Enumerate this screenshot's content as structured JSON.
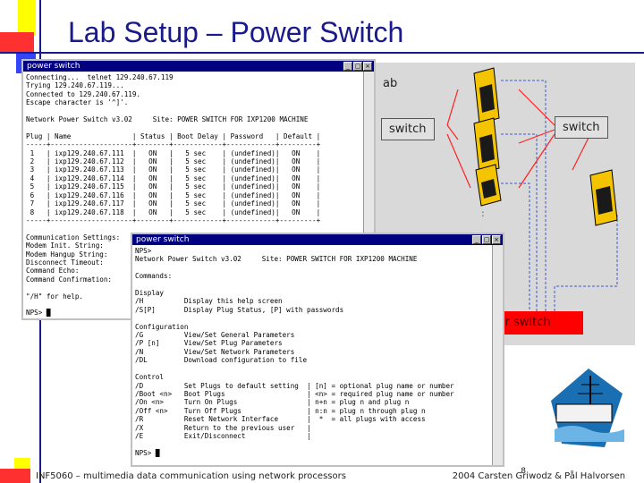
{
  "slide": {
    "title": "Lab Setup – Power Switch",
    "footer_left": "INF5060 – multimedia data communication using network processors",
    "footer_right": "2004  Carsten Griwodz & Pål Halvorsen",
    "page_number": "8"
  },
  "diagram": {
    "lab_label": "ab",
    "switch_left": "switch",
    "switch_right": "switch",
    "power_switch": "wer switch",
    "ellipsis": ":"
  },
  "window1": {
    "title": "power switch",
    "lines": [
      "Connecting...  telnet 129.240.67.119",
      "Trying 129.240.67.119...",
      "Connected to 129.240.67.119.",
      "Escape character is '^]'.",
      "",
      "Network Power Switch v3.02     Site: POWER SWITCH FOR IXP1200 MACHINE",
      "",
      "Plug | Name               | Status | Boot Delay | Password   | Default |",
      "-----+--------------------+--------+------------+------------+---------+",
      " 1   | ixp129.240.67.111  |   ON   |   5 sec    | (undefined)|   ON    |",
      " 2   | ixp129.240.67.112  |   ON   |   5 sec    | (undefined)|   ON    |",
      " 3   | ixp129.240.67.113  |   ON   |   5 sec    | (undefined)|   ON    |",
      " 4   | ixp129.240.67.114  |   ON   |   5 sec    | (undefined)|   ON    |",
      " 5   | ixp129.240.67.115  |   ON   |   5 sec    | (undefined)|   ON    |",
      " 6   | ixp129.240.67.116  |   ON   |   5 sec    | (undefined)|   ON    |",
      " 7   | ixp129.240.67.117  |   ON   |   5 sec    | (undefined)|   ON    |",
      " 8   | ixp129.240.67.118  |   ON   |   5 sec    | (undefined)|   ON    |",
      "-----+--------------------+--------+------------+------------+---------+",
      "",
      "Communication Settings:",
      "Modem Init. String:",
      "Modem Hangup String:",
      "Disconnect Timeout:",
      "Command Echo:",
      "Command Confirmation:",
      "",
      "\"/H\" for help.",
      "",
      "NPS> █"
    ]
  },
  "window2": {
    "title": "power switch",
    "lines": [
      "NPS>",
      "Network Power Switch v3.02     Site: POWER SWITCH FOR IXP1200 MACHINE",
      "",
      "Commands:",
      "",
      "Display",
      "/H          Display this help screen",
      "/S[P]       Display Plug Status, [P] with passwords",
      "",
      "Configuration",
      "/G          View/Set General Parameters",
      "/P [n]      View/Set Plug Parameters",
      "/N          View/Set Network Parameters",
      "/DL         Download configuration to file",
      "",
      "Control",
      "/D          Set Plugs to default setting  | [n] = optional plug name or number",
      "/Boot <n>   Boot Plugs                    | <n> = required plug name or number",
      "/On <n>     Turn On Plugs                 | n+n = plug n and plug n",
      "/Off <n>    Turn Off Plugs                | n:n = plug n through plug n",
      "/R          Reset Network Interface       |  *  = all plugs with access",
      "/X          Return to the previous user   |",
      "/E          Exit/Disconnect               |",
      "",
      "NPS> █"
    ]
  }
}
